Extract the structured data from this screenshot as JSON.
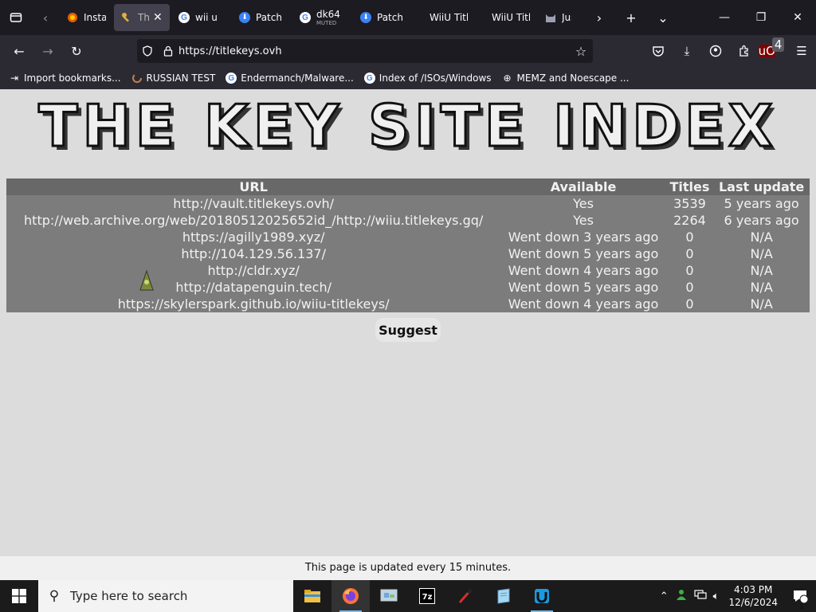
{
  "browser": {
    "tabs": [
      {
        "title": "Instal",
        "icon": "firefox-addon-icon",
        "active": false
      },
      {
        "title": "Th",
        "icon": "key-icon",
        "active": true
      },
      {
        "title": "wii u",
        "icon": "google-icon",
        "active": false
      },
      {
        "title": "Patch",
        "icon": "download-icon",
        "active": false
      },
      {
        "title": "dk64",
        "subtitle": "MUTED",
        "icon": "google-icon",
        "active": false
      },
      {
        "title": "Patch",
        "icon": "download-icon",
        "active": false
      },
      {
        "title": "WiiU Title",
        "icon": "",
        "active": false
      },
      {
        "title": "WiiU Title",
        "icon": "",
        "active": false
      },
      {
        "title": "Jus",
        "icon": "cat-icon",
        "active": false
      }
    ],
    "url": "https://titlekeys.ovh",
    "extension_badge": "4",
    "bookmarks": [
      {
        "label": "Import bookmarks...",
        "icon": "import-icon"
      },
      {
        "label": "RUSSIAN TEST",
        "icon": "loading-icon"
      },
      {
        "label": "Endermanch/Malware...",
        "icon": "google-icon"
      },
      {
        "label": "Index of /ISOs/Windows",
        "icon": "google-icon"
      },
      {
        "label": "MEMZ and Noescape ...",
        "icon": "globe-icon"
      }
    ]
  },
  "page": {
    "logo_text": "THE KEY SITE INDEX",
    "table": {
      "headers": [
        "URL",
        "Available",
        "Titles",
        "Last update"
      ],
      "rows": [
        [
          "http://vault.titlekeys.ovh/",
          "Yes",
          "3539",
          "5 years ago"
        ],
        [
          "http://web.archive.org/web/20180512025652id_/http://wiiu.titlekeys.gq/",
          "Yes",
          "2264",
          "6 years ago"
        ],
        [
          "https://agilly1989.xyz/",
          "Went down 3 years ago",
          "0",
          "N/A"
        ],
        [
          "http://104.129.56.137/",
          "Went down 5 years ago",
          "0",
          "N/A"
        ],
        [
          "http://cldr.xyz/",
          "Went down 4 years ago",
          "0",
          "N/A"
        ],
        [
          "http://datapenguin.tech/",
          "Went down 5 years ago",
          "0",
          "N/A"
        ],
        [
          "https://skylerspark.github.io/wiiu-titlekeys/",
          "Went down 4 years ago",
          "0",
          "N/A"
        ]
      ]
    },
    "suggest_label": "Suggest",
    "footer_text": "This page is updated every 15 minutes."
  },
  "taskbar": {
    "search_placeholder": "Type here to search",
    "time": "4:03 PM",
    "date": "12/6/2024",
    "notification_count": "1",
    "apps": [
      "file-explorer-icon",
      "firefox-icon",
      "control-panel-icon",
      "7zip-icon",
      "paint-icon",
      "notebook-icon",
      "wiiu-icon"
    ]
  }
}
